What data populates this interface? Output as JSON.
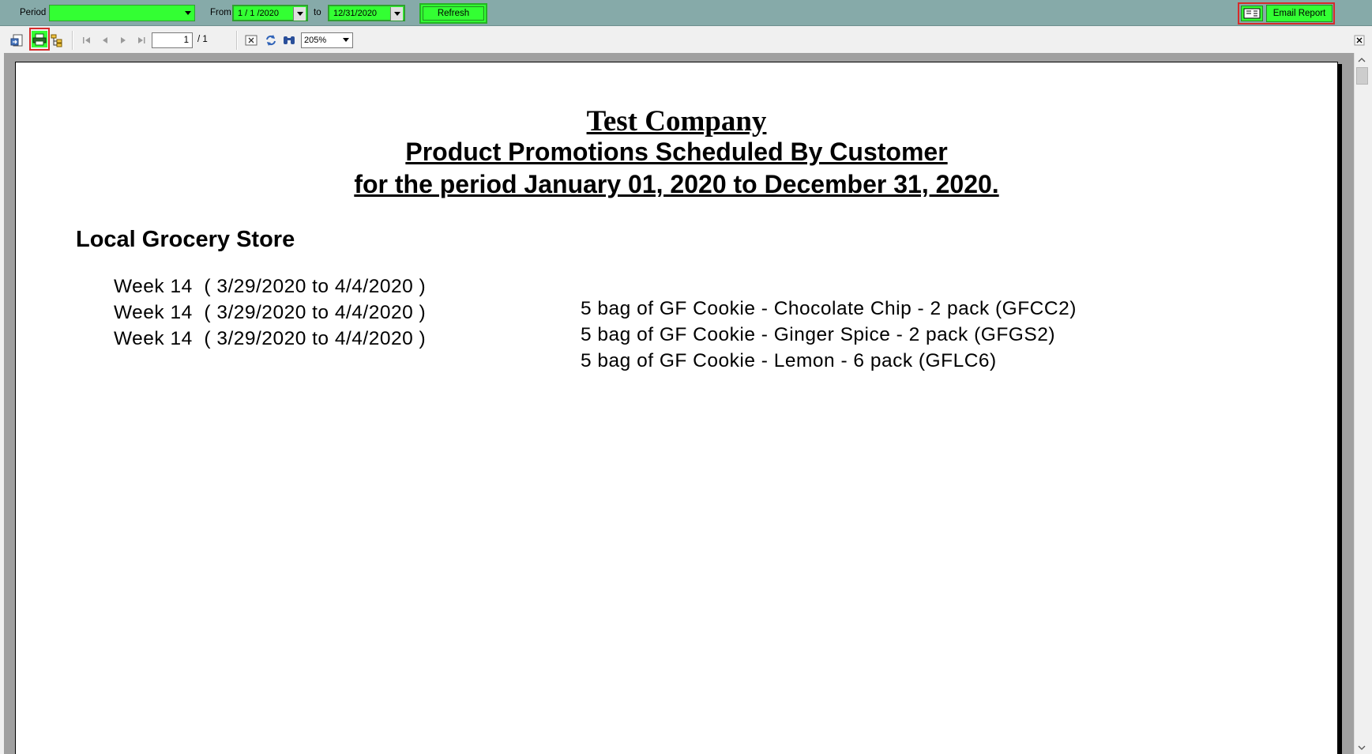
{
  "filters": {
    "period_label": "Period",
    "period_value": "",
    "from_label": "From",
    "from_value": "1 / 1 /2020",
    "to_label": "to",
    "to_value": "12/31/2020",
    "refresh_label": "Refresh",
    "email_label": "Email Report"
  },
  "toolbar": {
    "current_page": "1",
    "total_pages": "/ 1",
    "zoom": "205%"
  },
  "report": {
    "company": "Test Company",
    "title": "Product Promotions Scheduled By Customer",
    "period": "for the period January 01, 2020 to December 31, 2020.",
    "customer": "Local Grocery Store",
    "rows": [
      {
        "week": "Week 14  ( 3/29/2020 to 4/4/2020 )",
        "product": "5 bag of GF Cookie - Chocolate Chip - 2 pack (GFCC2)"
      },
      {
        "week": "Week 14  ( 3/29/2020 to 4/4/2020 )",
        "product": "5 bag of GF Cookie - Ginger Spice - 2 pack (GFGS2)"
      },
      {
        "week": "Week 14  ( 3/29/2020 to 4/4/2020 )",
        "product": "5 bag of GF Cookie - Lemon - 6 pack (GFLC6)"
      }
    ]
  },
  "colors": {
    "filter_bar": "#86aaa9",
    "green_control": "#33ff33",
    "highlight_red": "#d62a2a",
    "report_background": "#a0a0a0"
  },
  "icons": [
    "export-icon",
    "print-icon",
    "group-tree-icon",
    "first-page-icon",
    "previous-page-icon",
    "next-page-icon",
    "last-page-icon",
    "close-view-icon",
    "refresh-icon",
    "find-icon",
    "email-icon",
    "close-icon"
  ]
}
